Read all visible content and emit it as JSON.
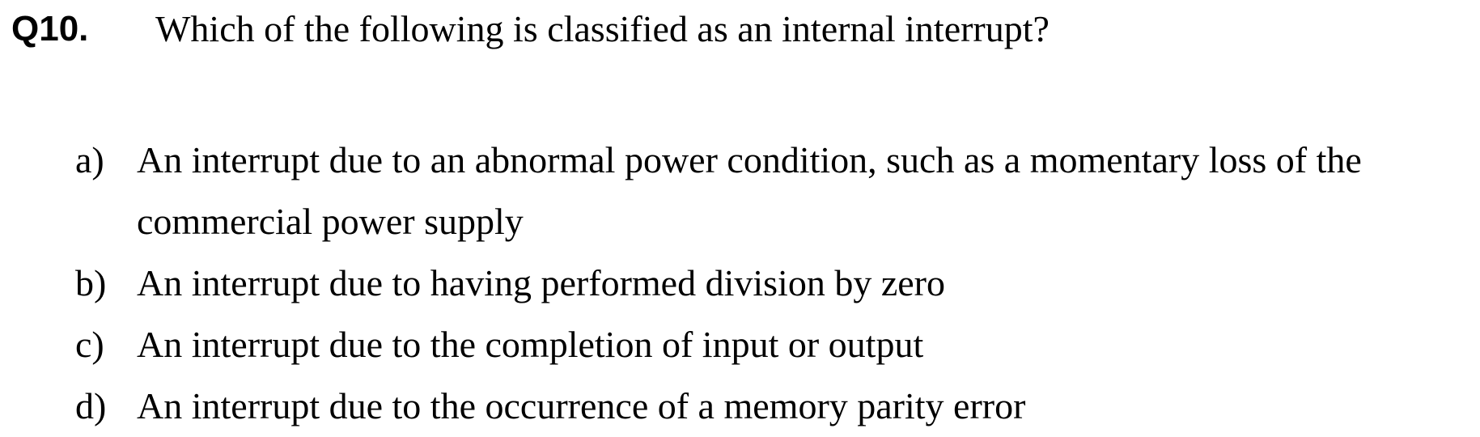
{
  "question": {
    "number": "Q10.",
    "text": "Which of the following is classified as an internal interrupt?"
  },
  "options": [
    {
      "letter": "a)",
      "text": "An interrupt due to an abnormal power condition, such as a momentary loss of the commercial power supply"
    },
    {
      "letter": "b)",
      "text": "An interrupt due to having performed division by zero"
    },
    {
      "letter": "c)",
      "text": "An interrupt due to the completion of input or output"
    },
    {
      "letter": "d)",
      "text": "An interrupt due to the occurrence of a memory parity error"
    }
  ]
}
